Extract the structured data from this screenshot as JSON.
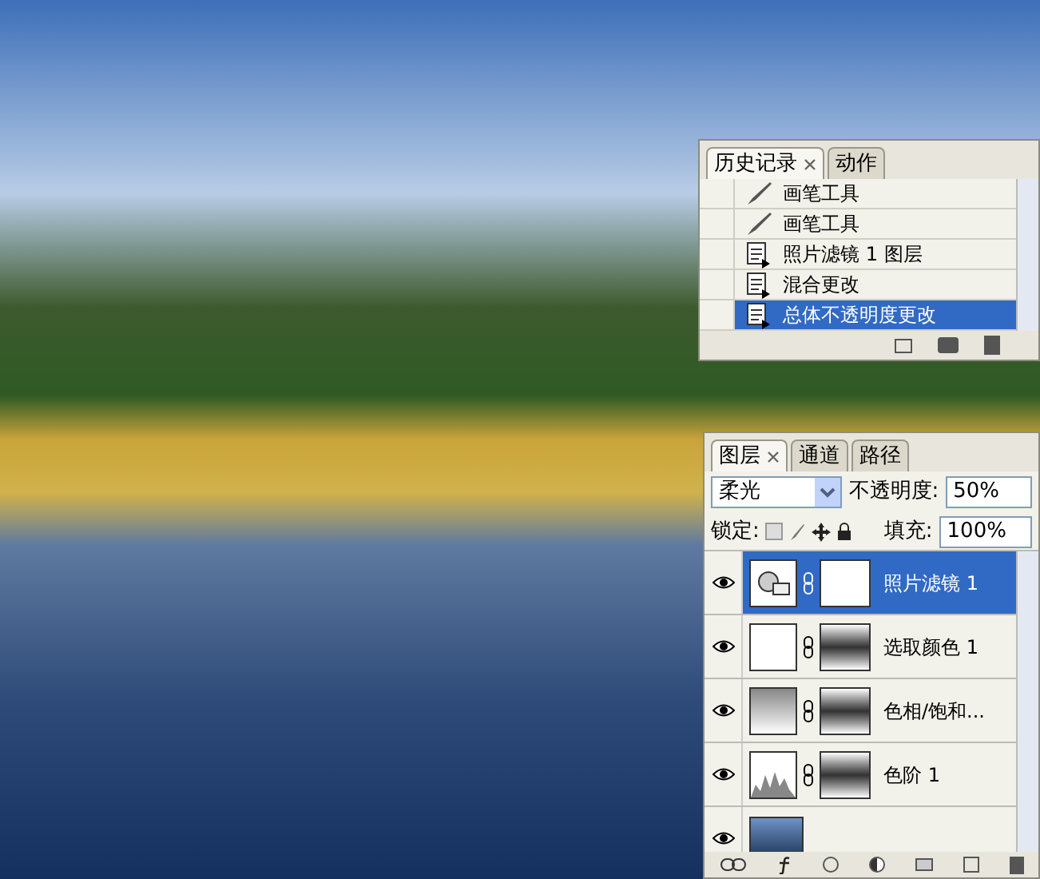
{
  "history": {
    "tabs": [
      {
        "label": "历史记录",
        "selected": true
      },
      {
        "label": "动作",
        "selected": false
      }
    ],
    "items": [
      {
        "label": "画笔工具",
        "kind": "brush",
        "selected": false
      },
      {
        "label": "画笔工具",
        "kind": "brush",
        "selected": false
      },
      {
        "label": "照片滤镜 1 图层",
        "kind": "doc",
        "selected": false
      },
      {
        "label": "混合更改",
        "kind": "doc",
        "selected": false
      },
      {
        "label": "总体不透明度更改",
        "kind": "doc",
        "selected": true
      }
    ]
  },
  "layers": {
    "tabs": [
      {
        "label": "图层",
        "selected": true
      },
      {
        "label": "通道",
        "selected": false
      },
      {
        "label": "路径",
        "selected": false
      }
    ],
    "blend_mode": "柔光",
    "opacity_label": "不透明度:",
    "opacity": "50%",
    "lock_label": "锁定:",
    "fill_label": "填充:",
    "fill": "100%",
    "items": [
      {
        "name": "照片滤镜 1",
        "kind": "photo-filter",
        "visible": true,
        "selected": true
      },
      {
        "name": "选取颜色 1",
        "kind": "selective",
        "visible": true,
        "selected": false
      },
      {
        "name": "色相/饱和...",
        "kind": "hue",
        "visible": true,
        "selected": false
      },
      {
        "name": "色阶 1",
        "kind": "levels",
        "visible": true,
        "selected": false
      },
      {
        "kind": "background",
        "visible": true,
        "selected": false
      }
    ]
  }
}
